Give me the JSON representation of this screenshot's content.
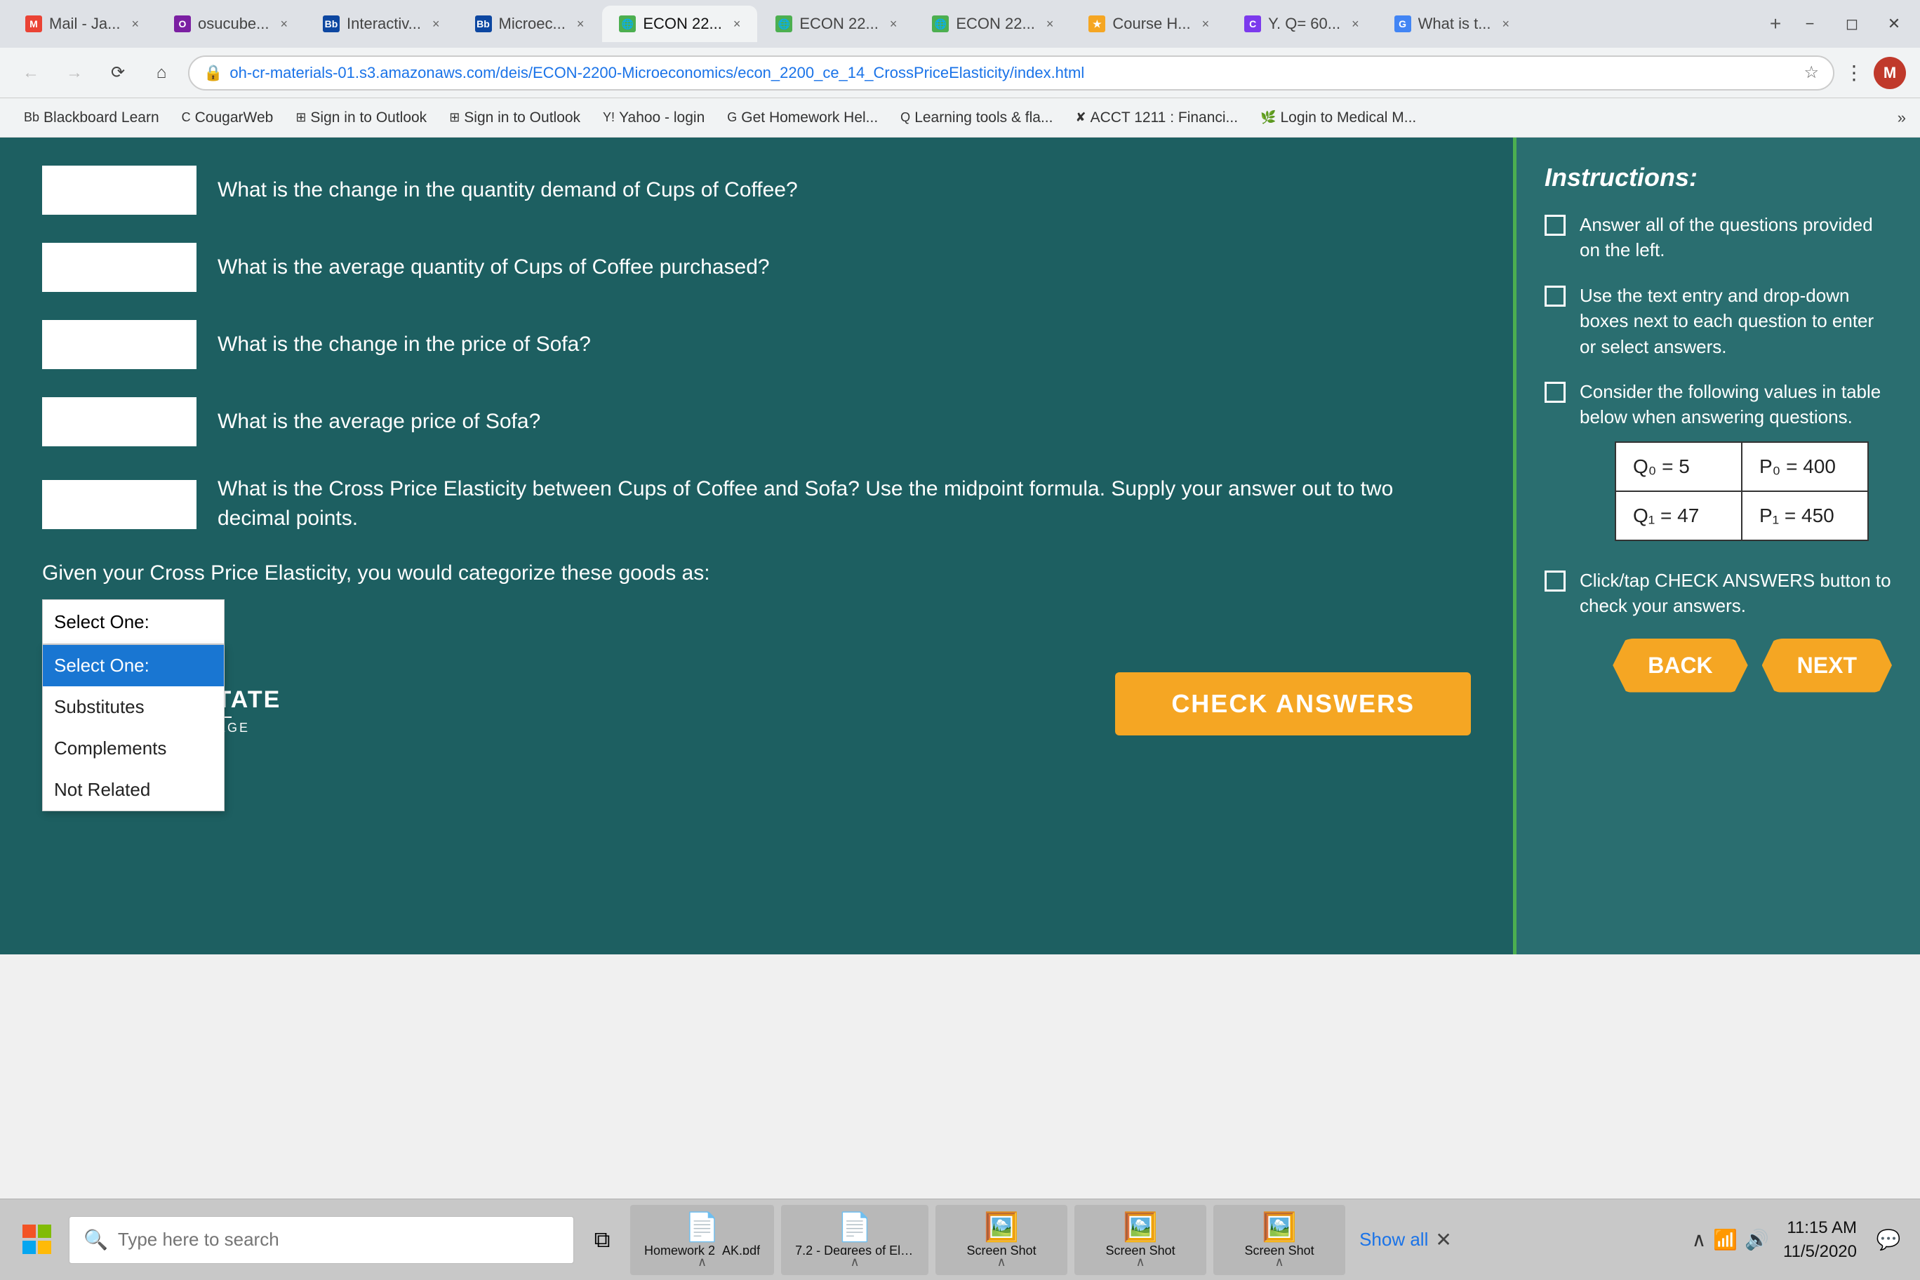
{
  "browser": {
    "tabs": [
      {
        "id": "mail",
        "label": "Mail - Ja...",
        "favicon_color": "#ea4335",
        "favicon_letter": "M",
        "active": false
      },
      {
        "id": "osucube",
        "label": "osucube...",
        "favicon_color": "#7b1fa2",
        "favicon_letter": "O",
        "active": false
      },
      {
        "id": "interactives",
        "label": "Interactiv...",
        "favicon_color": "#0d47a1",
        "favicon_letter": "Bb",
        "active": false
      },
      {
        "id": "microecon",
        "label": "Microec...",
        "favicon_color": "#0d47a1",
        "favicon_letter": "Bb",
        "active": false
      },
      {
        "id": "econ22_1",
        "label": "ECON 22...",
        "favicon_color": "#4caf50",
        "favicon_letter": "🌐",
        "active": true
      },
      {
        "id": "econ22_2",
        "label": "ECON 22...",
        "favicon_color": "#4caf50",
        "favicon_letter": "🌐",
        "active": false
      },
      {
        "id": "econ22_3",
        "label": "ECON 22...",
        "favicon_color": "#4caf50",
        "favicon_letter": "🌐",
        "active": false
      },
      {
        "id": "courseh",
        "label": "Course H...",
        "favicon_color": "#f5a623",
        "favicon_letter": "★",
        "active": false
      },
      {
        "id": "yq60",
        "label": "Y. Q= 60...",
        "favicon_color": "#7c3aed",
        "favicon_letter": "C",
        "active": false
      },
      {
        "id": "whatis",
        "label": "What is t...",
        "favicon_color": "#4285f4",
        "favicon_letter": "G",
        "active": false
      }
    ],
    "url": "oh-cr-materials-01.s3.amazonaws.com/deis/ECON-2200-Microeconomics/econ_2200_ce_14_CrossPriceElasticity/index.html",
    "bookmarks": [
      {
        "label": "Blackboard Learn",
        "icon": "Bb"
      },
      {
        "label": "CougarWeb",
        "icon": "C"
      },
      {
        "label": "Sign in to Outlook",
        "icon": "⊞"
      },
      {
        "label": "Sign in to Outlook",
        "icon": "⊞"
      },
      {
        "label": "Yahoo - login",
        "icon": "Y!"
      },
      {
        "label": "Get Homework Hel...",
        "icon": "G"
      },
      {
        "label": "Learning tools & fla...",
        "icon": "Q"
      },
      {
        "label": "ACCT 1211 : Financi...",
        "icon": "✘"
      },
      {
        "label": "Login to Medical M...",
        "icon": "🌿"
      }
    ]
  },
  "page": {
    "questions": [
      {
        "id": "q1",
        "text": "What is the change in the quantity demand of Cups of Coffee?"
      },
      {
        "id": "q2",
        "text": "What is the average quantity of Cups of Coffee purchased?"
      },
      {
        "id": "q3",
        "text": "What is the change in the price of Sofa?"
      },
      {
        "id": "q4",
        "text": "What is the average price of Sofa?"
      },
      {
        "id": "q5",
        "text": "What is the Cross Price Elasticity between Cups of Coffee  and Sofa? Use the midpoint formula. Supply your answer out to two decimal points."
      }
    ],
    "categorize_label": "Given your Cross Price Elasticity, you would categorize these goods as:",
    "select_placeholder": "Select One:",
    "dropdown_options": [
      {
        "id": "opt0",
        "label": "Select One:",
        "selected": true
      },
      {
        "id": "opt1",
        "label": "Substitutes",
        "selected": false
      },
      {
        "id": "opt2",
        "label": "Complements",
        "selected": false
      },
      {
        "id": "opt3",
        "label": "Not Related",
        "selected": false
      }
    ],
    "check_answers_label": "CHECK ANSWERS",
    "logo": {
      "name": "COLUMBUS STATE",
      "sub": "COMMUNITY COLLEGE"
    },
    "instructions": {
      "title": "Instructions:",
      "items": [
        "Answer all of the questions provided on the left.",
        "Use the text entry and drop-down boxes next to each question to enter or select answers.",
        "Consider the following values in table below when answering questions.",
        "Click/tap CHECK ANSWERS button to check your answers."
      ]
    },
    "table": {
      "q0": "Q₀ = 5",
      "p0": "P₀ = 400",
      "q1": "Q₁ = 47",
      "p1": "P₁ = 450"
    },
    "back_label": "BACK",
    "next_label": "NEXT"
  },
  "taskbar": {
    "search_placeholder": "Type here to search",
    "apps": [
      {
        "id": "pdf1",
        "label": "Homework 2_AK.pdf",
        "type": "pdf"
      },
      {
        "id": "pdf2",
        "label": "7.2 - Degrees of El....pdf",
        "type": "pdf"
      },
      {
        "id": "img1",
        "label": "Screen Shot",
        "type": "img"
      },
      {
        "id": "img2",
        "label": "Screen Shot",
        "type": "img"
      },
      {
        "id": "img3",
        "label": "Screen Shot",
        "type": "img"
      }
    ],
    "show_all": "Show all",
    "clock_time": "11:15 AM",
    "clock_date": "11/5/2020"
  }
}
